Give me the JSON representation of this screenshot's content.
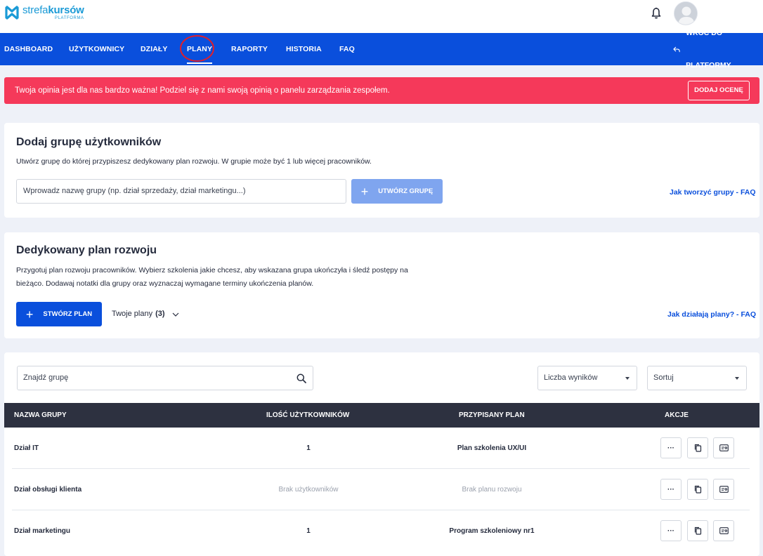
{
  "brand": {
    "name_light": "strefa",
    "name_bold": "kursów",
    "sub": "PLATFORMA",
    "color": "#1a9ad6"
  },
  "nav": {
    "items": [
      {
        "label": "DASHBOARD"
      },
      {
        "label": "UŻYTKOWNICY"
      },
      {
        "label": "DZIAŁY"
      },
      {
        "label": "PLANY",
        "active": true
      },
      {
        "label": "RAPORTY"
      },
      {
        "label": "HISTORIA"
      },
      {
        "label": "FAQ"
      }
    ],
    "back_label": "WRÓĆ DO PLATFORMY",
    "color": "#0a4fdc"
  },
  "alert": {
    "text": "Twoja opinia jest dla nas bardzo ważna! Podziel się z nami swoją opinią o panelu zarządzania zespołem.",
    "button": "DODAJ OCENĘ",
    "color": "#f5395a"
  },
  "add_group": {
    "title": "Dodaj grupę użytkowników",
    "desc": "Utwórz grupę do której przypiszesz dedykowany plan rozwoju. W grupie może być 1 lub więcej pracowników.",
    "input_placeholder": "Wprowadz nazwę grupy (np. dział sprzedaży, dział marketingu...)",
    "button": "UTWÓRZ GRUPĘ",
    "faq": "Jak tworzyć grupy - FAQ"
  },
  "plan": {
    "title": "Dedykowany plan rozwoju",
    "desc_line1": "Przygotuj plan rozwoju pracowników. Wybierz szkolenia jakie chcesz, aby wskazana grupa ukończyła i śledź postępy na",
    "desc_line2": "bieżąco. Dodawaj notatki dla grupy oraz wyznaczaj wymagane terminy ukończenia planów.",
    "button": "STWÓRZ PLAN",
    "dropdown_label": "Twoje plany",
    "dropdown_count": "(3)",
    "faq": "Jak działają plany? - FAQ"
  },
  "table": {
    "search_placeholder": "Znajdź grupę",
    "results_label": "Liczba wyników",
    "sort_label": "Sortuj",
    "headers": {
      "name": "NAZWA GRUPY",
      "users": "ILOŚĆ UŻYTKOWNIKÓW",
      "plan": "PRZYPISANY PLAN",
      "actions": "AKCJE"
    },
    "rows": [
      {
        "name": "Dział IT",
        "users": "1",
        "plan": "Plan szkolenia UX/UI",
        "muted": false
      },
      {
        "name": "Dział obsługi klienta",
        "users": "Brak użytkowników",
        "plan": "Brak planu rozwoju",
        "muted": true
      },
      {
        "name": "Dział marketingu",
        "users": "1",
        "plan": "Program szkoleniowy nr1",
        "muted": false
      }
    ],
    "more_label": "···"
  }
}
